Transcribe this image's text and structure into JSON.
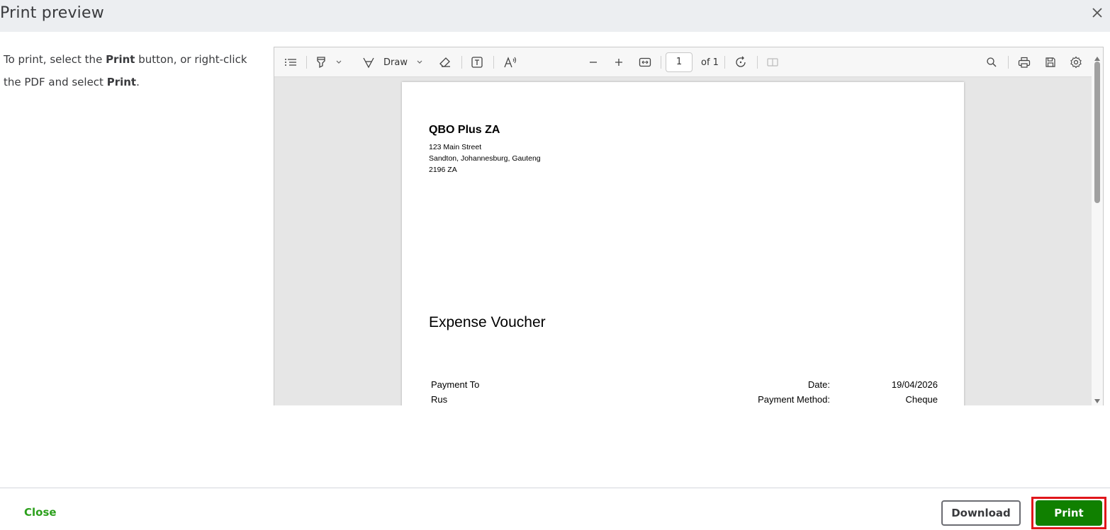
{
  "dialog": {
    "title": "Print preview",
    "instructions": {
      "part1": "To print, select the ",
      "bold1": "Print",
      "part2": " button, or right-click the PDF and select ",
      "bold2": "Print",
      "part3": "."
    }
  },
  "toolbar": {
    "draw_label": "Draw",
    "page_number": "1",
    "page_total": "of 1"
  },
  "document": {
    "company_name": "QBO Plus ZA",
    "address_line1": "123 Main Street",
    "address_line2": "Sandton, Johannesburg, Gauteng",
    "address_line3": "2196 ZA",
    "title": "Expense Voucher",
    "payment_to_label": "Payment To",
    "payment_to_value": "Rus",
    "date_label": "Date:",
    "date_value": "19/04/2026",
    "method_label": "Payment Method:",
    "method_value": "Cheque"
  },
  "footer": {
    "close_label": "Close",
    "download_label": "Download",
    "print_label": "Print"
  },
  "colors": {
    "accent_green": "#2ca01c",
    "print_button": "#108000",
    "highlight_red": "#e0161b"
  },
  "icons": [
    "close-icon",
    "contents-icon",
    "highlight-icon",
    "chevron-down-icon",
    "draw-icon",
    "eraser-icon",
    "text-box-icon",
    "read-aloud-icon",
    "zoom-out-icon",
    "zoom-in-icon",
    "fit-width-icon",
    "rotate-icon",
    "page-view-icon",
    "search-icon",
    "print-icon",
    "save-icon",
    "settings-icon"
  ]
}
